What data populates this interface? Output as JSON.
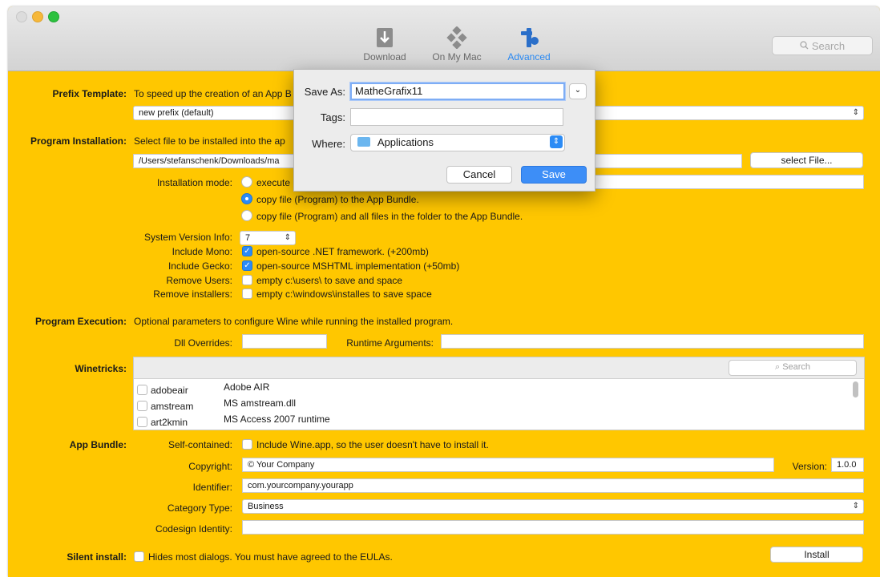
{
  "toolbar": {
    "items": [
      {
        "label": "Download",
        "icon": "download-icon"
      },
      {
        "label": "On My Mac",
        "icon": "on-my-mac-icon"
      },
      {
        "label": "Advanced",
        "icon": "tools-icon"
      }
    ],
    "search_placeholder": "Search"
  },
  "prefix_template": {
    "label": "Prefix Template:",
    "description": "To speed up the creation of an App B",
    "select_value": "new prefix (default)"
  },
  "program_installation": {
    "label": "Program Installation:",
    "description": "Select file to be installed into the ap",
    "path_value": "/Users/stefanschenk/Downloads/ma",
    "select_file_button": "select File...",
    "installation_mode_label": "Installation mode:",
    "modes": [
      {
        "label": "execute",
        "selected": false
      },
      {
        "label": "copy file (Program)  to the App Bundle.",
        "selected": true
      },
      {
        "label": "copy file (Program)  and all files in the folder to the App Bundle.",
        "selected": false
      }
    ]
  },
  "options": {
    "system_version_label": "System Version Info:",
    "system_version_value": "7",
    "include_mono_label": "Include Mono:",
    "include_mono_text": "open-source .NET framework. (+200mb)",
    "include_mono_checked": true,
    "include_gecko_label": "Include Gecko:",
    "include_gecko_text": "open-source MSHTML implementation (+50mb)",
    "include_gecko_checked": true,
    "remove_users_label": "Remove Users:",
    "remove_users_text": "empty c:\\users\\ to save and space",
    "remove_users_checked": false,
    "remove_installers_label": "Remove installers:",
    "remove_installers_text": "empty c:\\windows\\installes to save space",
    "remove_installers_checked": false
  },
  "program_execution": {
    "label": "Program Execution:",
    "description": "Optional parameters to configure Wine while running the installed program.",
    "dll_label": "Dll Overrides:",
    "dll_value": "",
    "runtime_label": "Runtime Arguments:",
    "runtime_value": ""
  },
  "winetricks": {
    "label": "Winetricks:",
    "search_placeholder": "Search",
    "rows": [
      {
        "name": "adobeair",
        "desc": "Adobe AIR"
      },
      {
        "name": "amstream",
        "desc": "MS amstream.dll"
      },
      {
        "name": "art2kmin",
        "desc": "MS Access 2007 runtime"
      }
    ]
  },
  "app_bundle": {
    "label": "App Bundle:",
    "self_contained_label": "Self-contained:",
    "self_contained_text": "Include Wine.app, so the user doesn't have to install it.",
    "copyright_label": "Copyright:",
    "copyright_value": "© Your Company",
    "version_label": "Version:",
    "version_value": "1.0.0",
    "identifier_label": "Identifier:",
    "identifier_value": "com.yourcompany.yourapp",
    "category_label": "Category Type:",
    "category_value": "Business",
    "codesign_label": "Codesign Identity:",
    "codesign_value": ""
  },
  "silent_install": {
    "label": "Silent install:",
    "text": "Hides most dialogs. You must have agreed to the EULAs.",
    "install_button": "Install"
  },
  "save_dialog": {
    "save_as_label": "Save As:",
    "save_as_value": "MatheGrafix11",
    "tags_label": "Tags:",
    "tags_value": "",
    "where_label": "Where:",
    "where_value": "Applications",
    "cancel_button": "Cancel",
    "save_button": "Save"
  },
  "colors": {
    "background": "#ffc700",
    "accent": "#2b8bf5"
  }
}
